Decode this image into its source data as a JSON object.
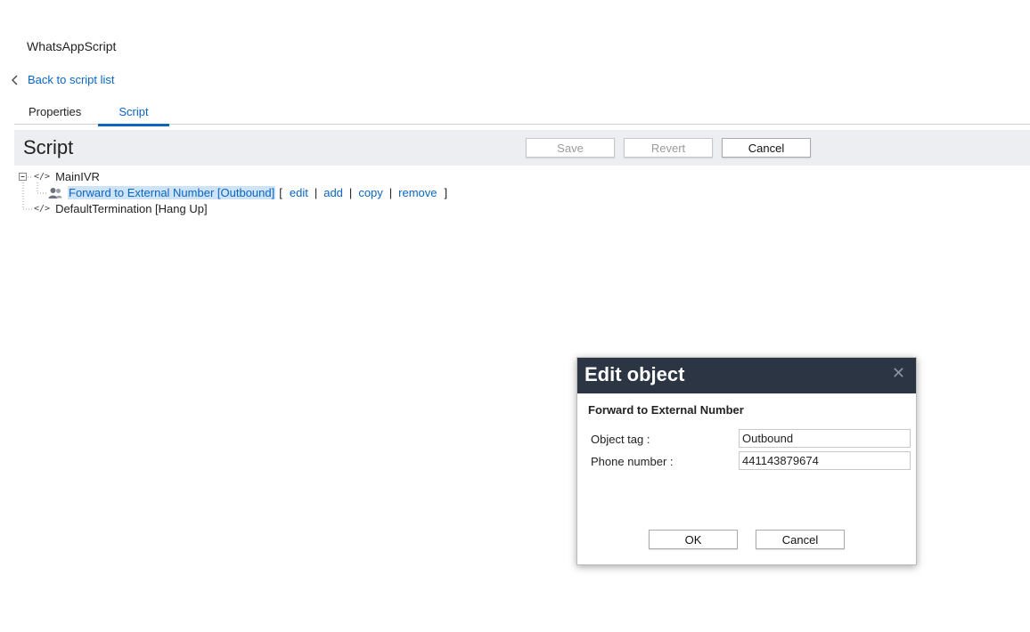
{
  "app": {
    "title": "WhatsAppScript"
  },
  "nav": {
    "back_label": "Back to script list"
  },
  "tabs": [
    {
      "label": "Properties",
      "active": false
    },
    {
      "label": "Script",
      "active": true
    }
  ],
  "script_bar": {
    "title": "Script",
    "save_label": "Save",
    "revert_label": "Revert",
    "cancel_label": "Cancel"
  },
  "tree": {
    "root": {
      "label": "MainIVR",
      "icon": "code-icon"
    },
    "child": {
      "label": "Forward to External Number [Outbound]",
      "icon": "users-icon",
      "selected": true,
      "actions": [
        "edit",
        "add",
        "copy",
        "remove"
      ]
    },
    "sibling": {
      "label": "DefaultTermination [Hang Up]",
      "icon": "code-icon"
    }
  },
  "dialog": {
    "title": "Edit object",
    "close_icon": "close-icon",
    "subtitle": "Forward to External Number",
    "fields": [
      {
        "label": "Object tag :",
        "value": "Outbound"
      },
      {
        "label": "Phone number :",
        "value": "441143879674"
      }
    ],
    "ok_label": "OK",
    "cancel_label": "Cancel"
  },
  "colors": {
    "accent": "#0a66c2",
    "selection": "#cfe3f7",
    "toolbar_bg": "#eceef1",
    "dialog_header": "#2b3543"
  }
}
